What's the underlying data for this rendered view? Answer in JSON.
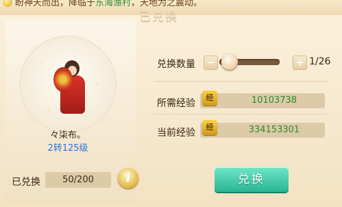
{
  "banner": {
    "prefix": "盼神天而出，降临于",
    "highlight": "东海渔村",
    "suffix": "，天地为之震动。",
    "tab_title": "已兑换"
  },
  "character": {
    "name": "々柒布。",
    "level": "2转125级"
  },
  "redeemed": {
    "label": "已兑换",
    "value": "50/200"
  },
  "info_icon": {
    "glyph": "i"
  },
  "exchange": {
    "quantity_label": "兑换数量",
    "minus": "−",
    "plus": "+",
    "quantity": "1/26",
    "slider_fraction": 0.04
  },
  "required_exp": {
    "label": "所需经验",
    "value": "10103738"
  },
  "current_exp": {
    "label": "当前经验",
    "value": "334153301"
  },
  "redeem_button": {
    "label": "兑换"
  },
  "colors": {
    "accent_green": "#2f8a2a",
    "button_teal": "#29b594",
    "level_blue": "#2d6fd6"
  }
}
